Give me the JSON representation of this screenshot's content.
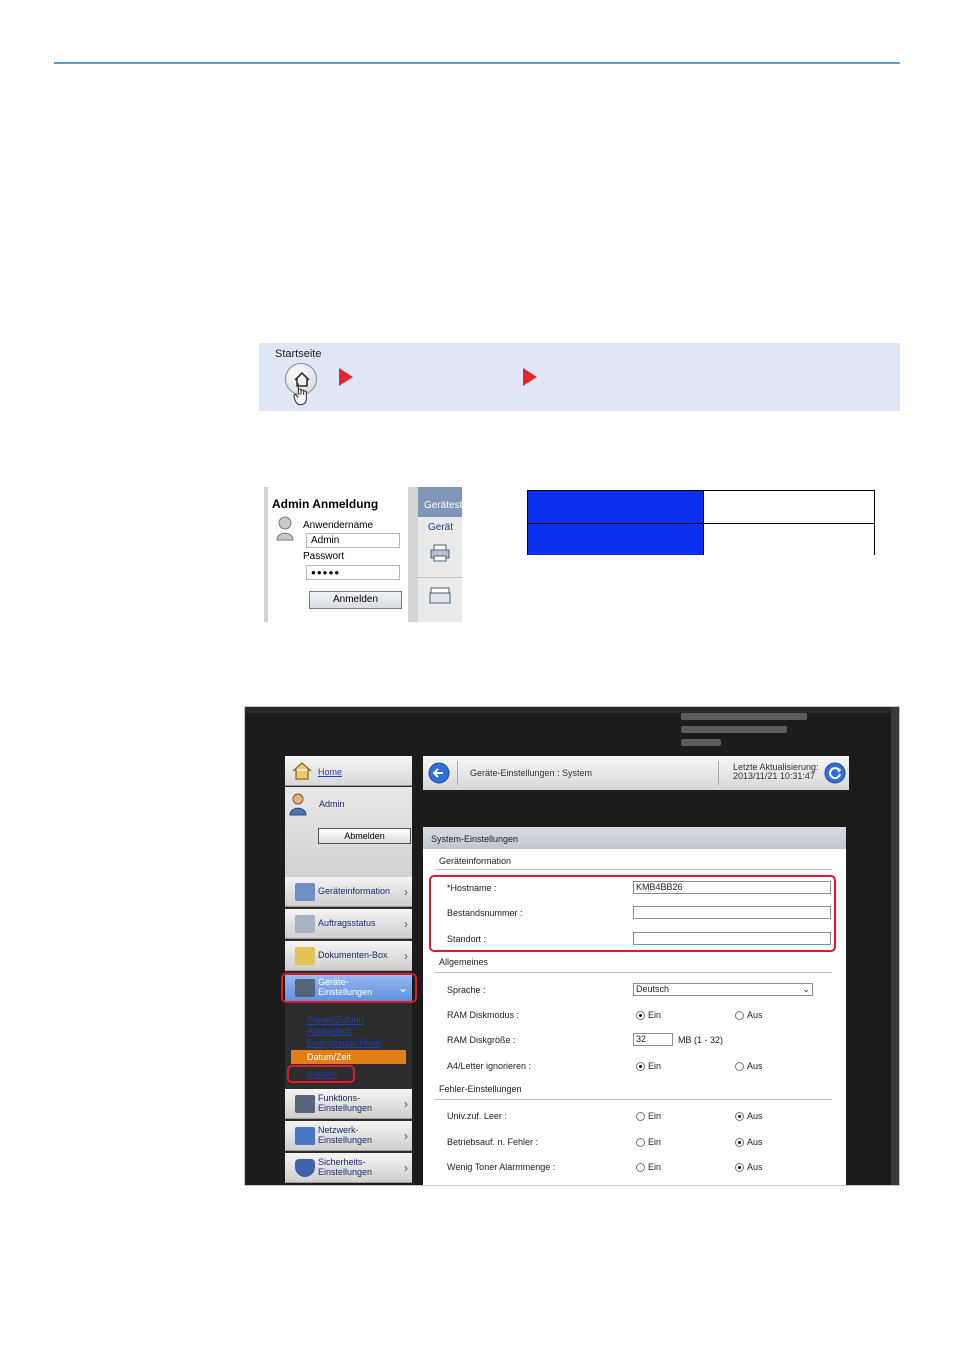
{
  "stepbar": {
    "start_label": "Startseite"
  },
  "login": {
    "title": "Admin Anmeldung",
    "username_label": "Anwendername",
    "username_value": "Admin",
    "password_label": "Passwort",
    "password_value": "●●●●●",
    "login_button": "Anmelden",
    "tab_partial": "Gerätest",
    "sub_tab": "Gerät"
  },
  "browser": {
    "nav": {
      "home": "Home",
      "user": "Admin",
      "logout": "Abmelden",
      "items": [
        "Geräteinformation",
        "Auftragsstatus",
        "Dokumenten-Box",
        "Geräte-\nEinstellungen",
        "Funktions-\nEinstellungen",
        "Netzwerk-\nEinstellungen",
        "Sicherheits-\nEinstellungen"
      ],
      "sub_links": [
        "Papier/Zufuhr/",
        "Ablagefach",
        "Energiespar/Timer",
        "Datum/Zeit",
        "System"
      ]
    },
    "header": {
      "breadcrumb": "Geräte-Einstellungen : System",
      "updated_label": "Letzte Aktualisierung:",
      "updated_value": "2013/11/21 10:31:47"
    },
    "content": {
      "title": "System-Einstellungen",
      "section_device": "Geräteinformation",
      "hostname_label": "*Hostname :",
      "hostname_value": "KMB4BB26",
      "asset_label": "Bestandsnummer :",
      "location_label": "Standort :",
      "section_general": "Allgemeines",
      "language_label": "Sprache :",
      "language_value": "Deutsch",
      "ramdisk_label": "RAM Diskmodus :",
      "ramsize_label": "RAM Diskgröße :",
      "ramsize_value": "32",
      "ramsize_unit": "MB (1 - 32)",
      "a4_label": "A4/Letter ignorieren :",
      "section_errors": "Fehler-Einstellungen",
      "univ_label": "Univ.zuf. Leer :",
      "opfault_label": "Betriebsauf. n. Fehler :",
      "toner_label": "Wenig Toner Alarmmenge :",
      "on": "Ein",
      "off": "Aus"
    }
  }
}
